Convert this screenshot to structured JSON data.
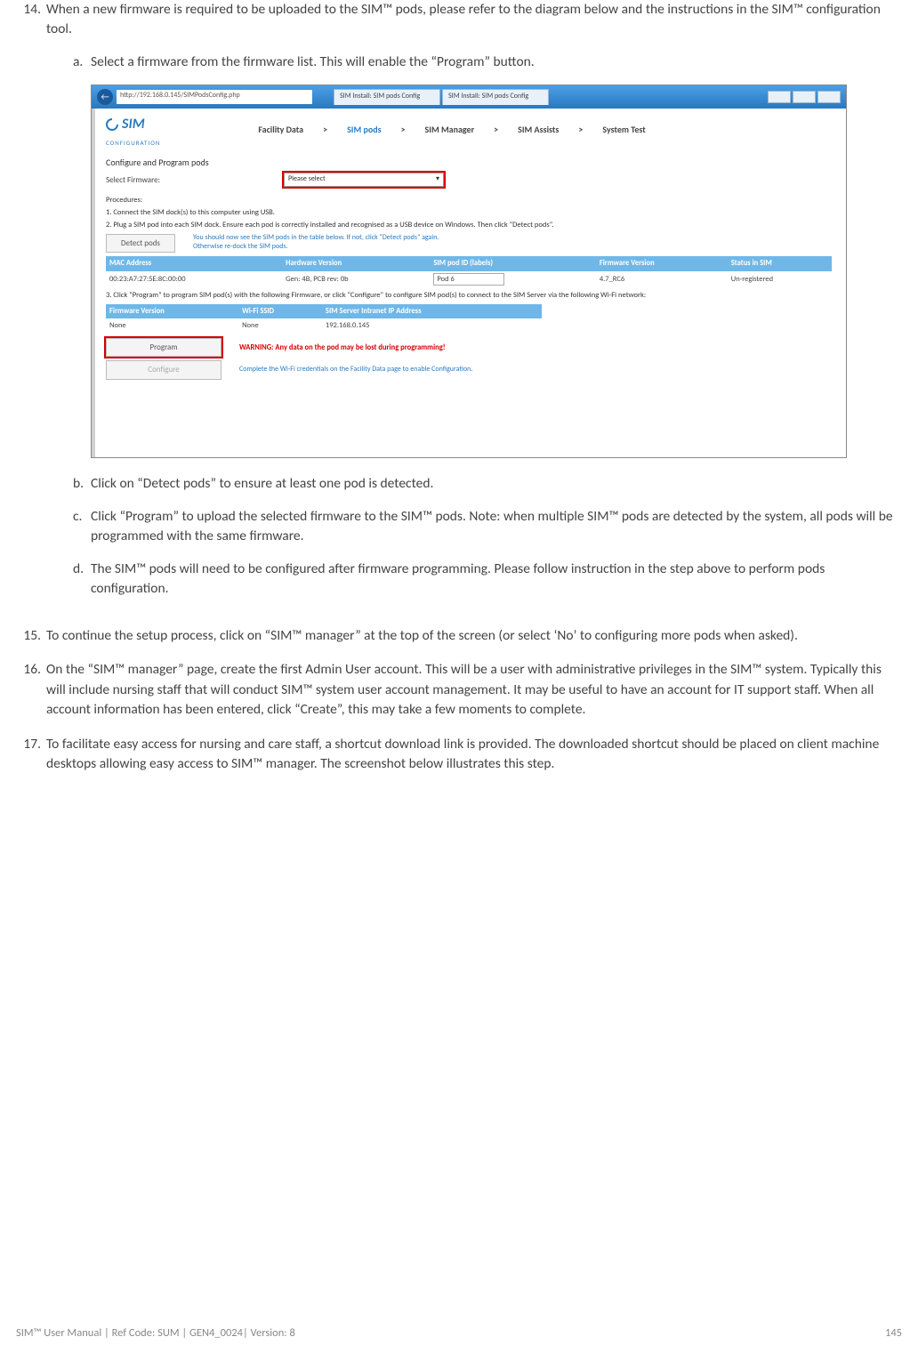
{
  "list": {
    "item14": {
      "num": "14.",
      "text": "When a new firmware is required to be uploaded to the SIM™ pods, please refer to the diagram below and the instructions in the SIM™ configuration tool.",
      "a": {
        "letter": "a.",
        "text": "Select a firmware from the firmware list. This will enable the “Program” button."
      },
      "b": {
        "letter": "b.",
        "text": "Click on “Detect pods” to ensure at least one pod is detected."
      },
      "c": {
        "letter": "c.",
        "text": "Click “Program” to upload the selected firmware to the SIM™ pods. Note: when multiple SIM™ pods are detected by the system, all pods will be programmed with the same firmware."
      },
      "d": {
        "letter": "d.",
        "text": "The SIM™ pods will need to be configured after firmware programming. Please follow instruction in the step above to perform pods configuration."
      }
    },
    "item15": {
      "num": "15.",
      "text": "To continue the setup process, click on “SIM™ manager” at the top of the screen (or select ‘No’ to configuring more pods when asked)."
    },
    "item16": {
      "num": "16.",
      "text": "On the “SIM™ manager” page, create the first Admin User account.  This will be a user with administrative privileges in the SIM™ system.  Typically this will include nursing staff that will conduct SIM™ system user account management.  It may be useful to have an account for IT support staff.  When all account information has been entered, click “Create”, this may take a few moments to complete."
    },
    "item17": {
      "num": "17.",
      "text": "To facilitate easy access for nursing and care staff, a shortcut download link is provided.  The downloaded shortcut should be placed on client machine desktops allowing easy access to SIM™ manager. The screenshot below illustrates this step."
    }
  },
  "screenshot": {
    "back_icon": "←",
    "address": "http://192.168.0.145/SIMPodsConfig.php",
    "tab1": "SIM Install: SIM pods Config",
    "tab2": "SIM Install: SIM pods Config",
    "brand": "SIM",
    "brand_sub": "CONFIGURATION",
    "nav": {
      "facility": "Facility Data",
      "pods": "SIM pods",
      "manager": "SIM Manager",
      "assists": "SIM Assists",
      "test": "System Test",
      "sep": ">"
    },
    "section_title": "Configure and Program pods",
    "select_label": "Select Firmware:",
    "select_placeholder": "Please select",
    "select_caret": "▾",
    "procedures_label": "Procedures:",
    "proc1": "1. Connect the SIM dock(s) to this computer using USB.",
    "proc2": "2. Plug a SIM pod into each SIM dock. Ensure each pod is correctly installed and recognised as a USB device on Windows. Then click “Detect pods”.",
    "detect_btn": "Detect pods",
    "hint1": "You should now see the SIM pods in the table below. If not, click “Detect pods” again.",
    "hint2": "Otherwise re-dock the SIM pods.",
    "table1": {
      "h1": "MAC Address",
      "h2": "Hardware Version",
      "h3": "SIM pod ID (labels)",
      "h4": "Firmware Version",
      "h5": "Status in SIM",
      "r1c1": "00:23:A7:27:5E:8C:00:00",
      "r1c2": "Gen: 4B, PCB rev: 0b",
      "r1c3": "Pod 6",
      "r1c4": "4.7_RC6",
      "r1c5": "Un-registered"
    },
    "proc3": "3. Click “Program” to program SIM pod(s) with the following Firmware, or click “Configure” to configure SIM pod(s) to connect to the SIM Server via the following Wi-Fi network:",
    "table2": {
      "h1": "Firmware Version",
      "h2": "Wi-Fi SSID",
      "h3": "SIM Server Intranet IP Address",
      "r1c1": "None",
      "r1c2": "None",
      "r1c3": "192.168.0.145"
    },
    "program_btn": "Program",
    "configure_btn": "Configure",
    "warning": "WARNING: Any data on the pod may be lost during programming!",
    "config_note": "Complete the Wi-Fi credentials on the Facility Data page to enable Configuration."
  },
  "footer": {
    "left": "SIM™ User Manual | Ref Code: SUM | GEN4_0024| Version: 8",
    "right": "145"
  }
}
